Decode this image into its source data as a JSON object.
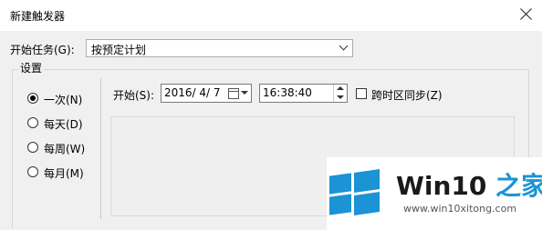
{
  "window": {
    "title": "新建触发器"
  },
  "start_task": {
    "label": "开始任务(G):",
    "value": "按预定计划"
  },
  "settings": {
    "legend": "设置",
    "frequency_options": [
      {
        "label": "一次(N)",
        "checked": true
      },
      {
        "label": "每天(D)",
        "checked": false
      },
      {
        "label": "每周(W)",
        "checked": false
      },
      {
        "label": "每月(M)",
        "checked": false
      }
    ],
    "start_label": "开始(S):",
    "start_date": "2016/ 4/ 7",
    "start_time": "16:38:40",
    "sync_timezone_label": "跨时区同步(Z)",
    "sync_timezone_checked": false
  },
  "watermark": {
    "brand": "Win10",
    "brand_suffix": "之家",
    "url": "www.win10xitong.com",
    "logo_color": "#1b93d5"
  },
  "icons": [
    "close-icon",
    "chevron-down-icon",
    "calendar-icon",
    "spin-up-icon",
    "spin-down-icon",
    "windows-logo-icon"
  ]
}
